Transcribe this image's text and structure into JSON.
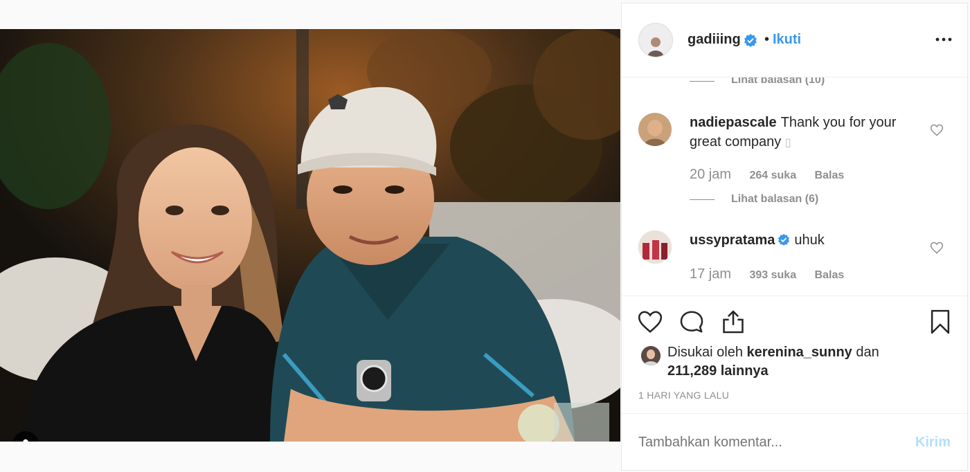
{
  "post": {
    "author": "gadiiing",
    "dot": "•",
    "follow_label": "Ikuti"
  },
  "comments": {
    "prev_replies": "Lihat balasan (10)",
    "items": [
      {
        "username": "nadiepascale",
        "text": "Thank you for your great company",
        "emoji": "▯",
        "time": "20 jam",
        "likes": "264 suka",
        "reply": "Balas",
        "view_replies": "Lihat balasan (6)"
      },
      {
        "username": "ussypratama",
        "verified": true,
        "text": "uhuk",
        "time": "17 jam",
        "likes": "393 suka",
        "reply": "Balas"
      }
    ]
  },
  "likes": {
    "prefix": "Disukai oleh",
    "user": "kerenina_sunny",
    "and": "dan",
    "count": "211,289 lainnya"
  },
  "timestamp": "1 HARI YANG LALU",
  "add_comment": {
    "placeholder": "Tambahkan komentar...",
    "send_label": "Kirim"
  },
  "colors": {
    "accent": "#3897f0",
    "send_disabled": "#b2dffc",
    "muted": "#8e8e8e"
  },
  "icons": [
    "verified-badge-icon",
    "more-icon",
    "heart-icon",
    "comment-icon",
    "share-icon",
    "bookmark-icon",
    "user-tag-icon"
  ]
}
